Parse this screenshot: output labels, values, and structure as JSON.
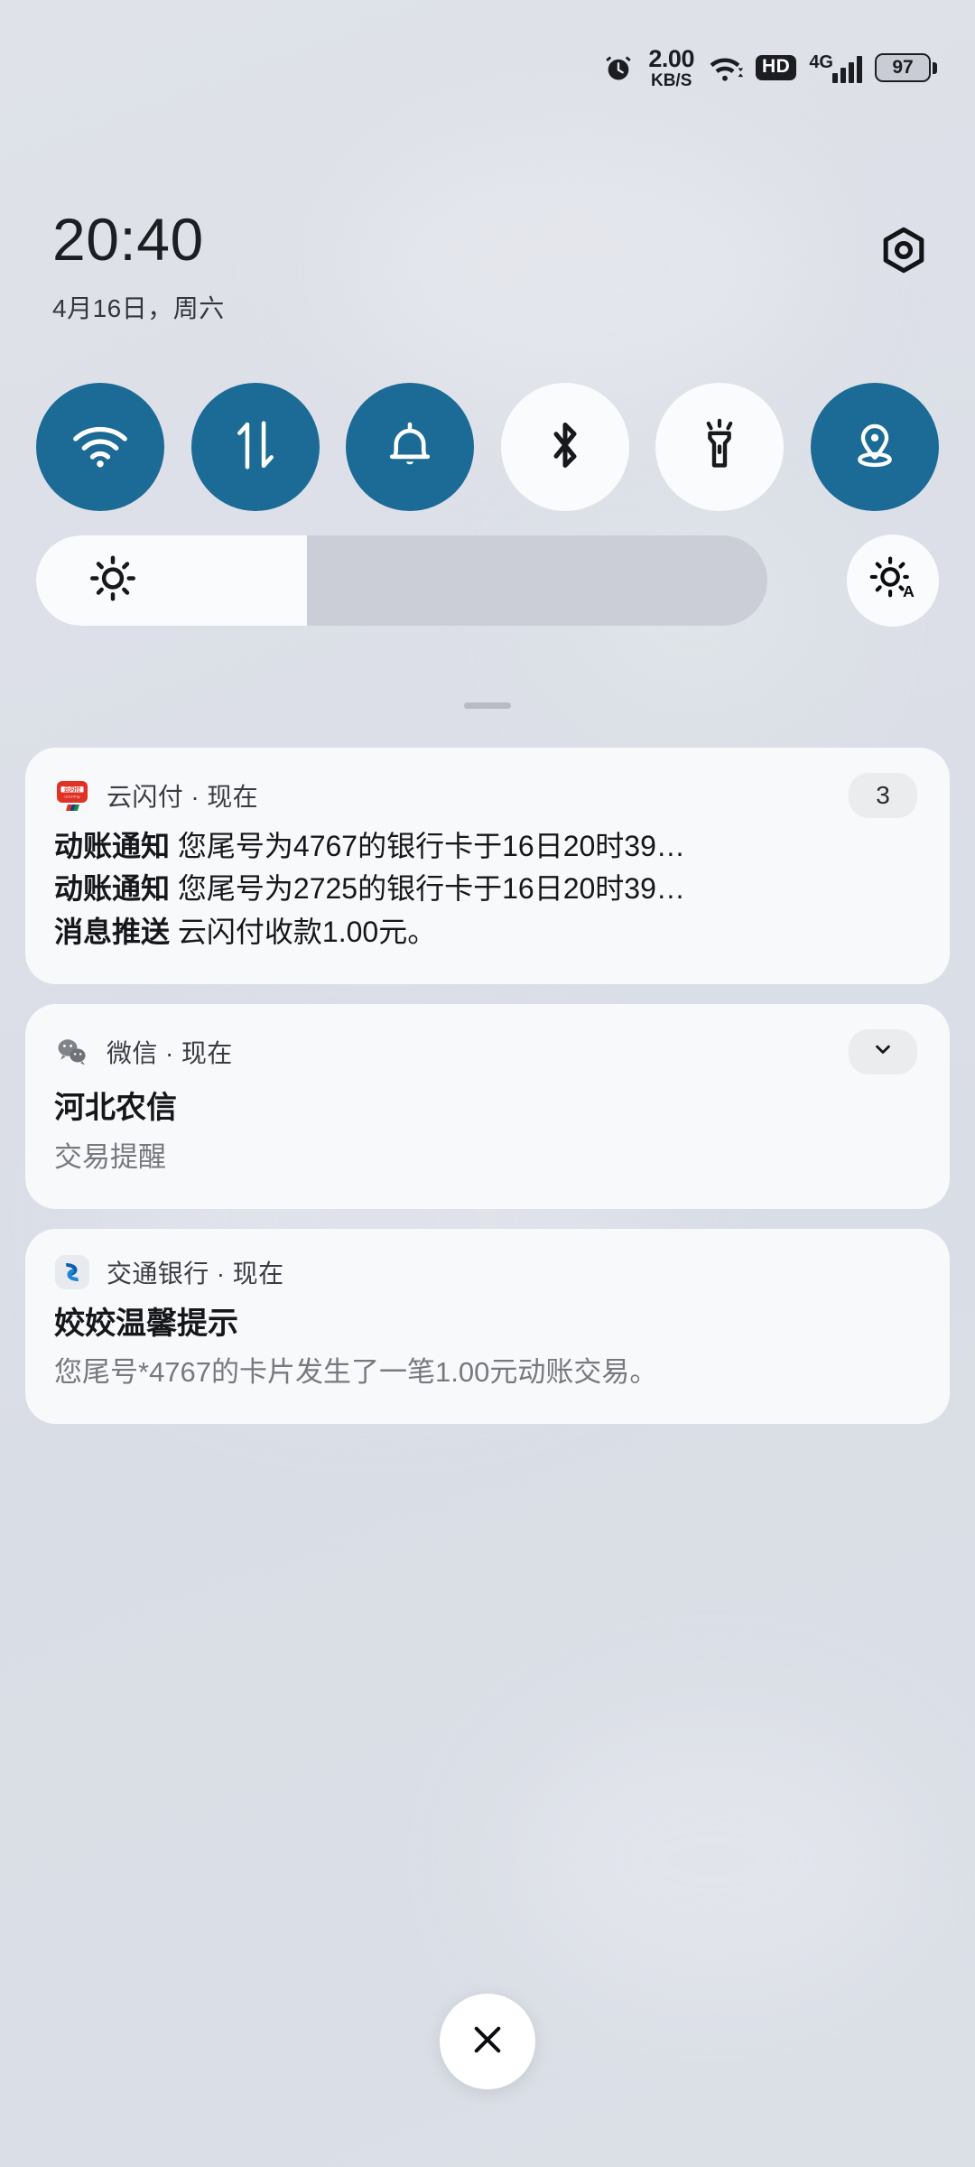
{
  "status_bar": {
    "alarm_icon": "alarm-clock-icon",
    "net_speed_value": "2.00",
    "net_speed_unit": "KB/S",
    "wifi_icon": "wifi-icon",
    "hd_badge": "HD",
    "network_type": "4G",
    "signal_icon": "signal-bars-icon",
    "battery_level": "97"
  },
  "header": {
    "time": "20:40",
    "date": "4月16日，周六",
    "settings_icon": "settings-gear-icon"
  },
  "quick_toggles": [
    {
      "name": "wifi",
      "icon": "wifi-icon",
      "state": "on"
    },
    {
      "name": "mobile-data",
      "icon": "data-arrows-icon",
      "state": "on"
    },
    {
      "name": "ringer",
      "icon": "bell-icon",
      "state": "on"
    },
    {
      "name": "bluetooth",
      "icon": "bluetooth-icon",
      "state": "off"
    },
    {
      "name": "flashlight",
      "icon": "flashlight-icon",
      "state": "off"
    },
    {
      "name": "location",
      "icon": "location-pin-icon",
      "state": "on"
    }
  ],
  "brightness": {
    "slider_icon": "brightness-sun-icon",
    "fill_percent": 37,
    "auto_icon": "brightness-auto-icon"
  },
  "drag_handle": "panel-drag-handle",
  "notifications": [
    {
      "app_name": "云闪付 · 现在",
      "app_icon": "unionpay-app-icon",
      "badge": "3",
      "badge_type": "count",
      "lines": [
        {
          "lead": "动账通知",
          "text": "您尾号为4767的银行卡于16日20时39…"
        },
        {
          "lead": "动账通知",
          "text": "您尾号为2725的银行卡于16日20时39…"
        },
        {
          "lead": "消息推送",
          "text": "云闪付收款1.00元。"
        }
      ]
    },
    {
      "app_name": "微信 · 现在",
      "app_icon": "wechat-app-icon",
      "badge": "",
      "badge_type": "chevron",
      "title": "河北农信",
      "body": "交易提醒"
    },
    {
      "app_name": "交通银行 · 现在",
      "app_icon": "bankcomm-app-icon",
      "badge": "",
      "badge_type": "none",
      "title": "姣姣温馨提示",
      "body": "您尾号*4767的卡片发生了一笔1.00元动账交易。"
    }
  ],
  "close_button": {
    "icon": "close-x-icon"
  },
  "colors": {
    "toggle_on": "#1b6b96",
    "toggle_off": "#fafbfc",
    "card_bg": "#f8f9fa",
    "panel_bg": "#dcdfe7"
  }
}
